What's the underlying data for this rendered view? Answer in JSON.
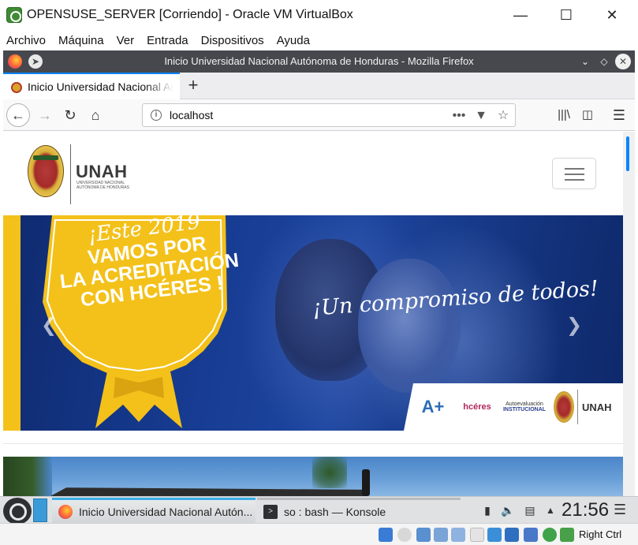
{
  "vbox": {
    "title": "OPENSUSE_SERVER [Corriendo] - Oracle VM VirtualBox",
    "menu": [
      "Archivo",
      "Máquina",
      "Ver",
      "Entrada",
      "Dispositivos",
      "Ayuda"
    ],
    "host_key": "Right Ctrl"
  },
  "firefox": {
    "window_title": "Inicio Universidad Nacional Autónoma de Honduras - Mozilla Firefox",
    "tab_title": "Inicio Universidad Nacional Autónoma de Honduras",
    "url": "localhost"
  },
  "site": {
    "logo_text": "UNAH",
    "logo_subtitle": "Universidad Nacional Autónoma de Honduras",
    "hero": {
      "badge_line0": "¡Este 2019",
      "badge_line1": "VAMOS POR",
      "badge_line2": "LA ACREDITACIÓN",
      "badge_line3": "CON HCÉRES !",
      "slogan": "¡Un compromiso de todos!",
      "partner_acap": "A+",
      "partner_hceres": "hcéres",
      "partner_ai_line1": "Autoevaluación",
      "partner_ai_line2": "INSTITUCIONAL",
      "partner_unah": "UNAH"
    }
  },
  "taskbar": {
    "task1": "Inicio Universidad Nacional Autón...",
    "task2": "so : bash — Konsole",
    "clock": "21:56"
  }
}
